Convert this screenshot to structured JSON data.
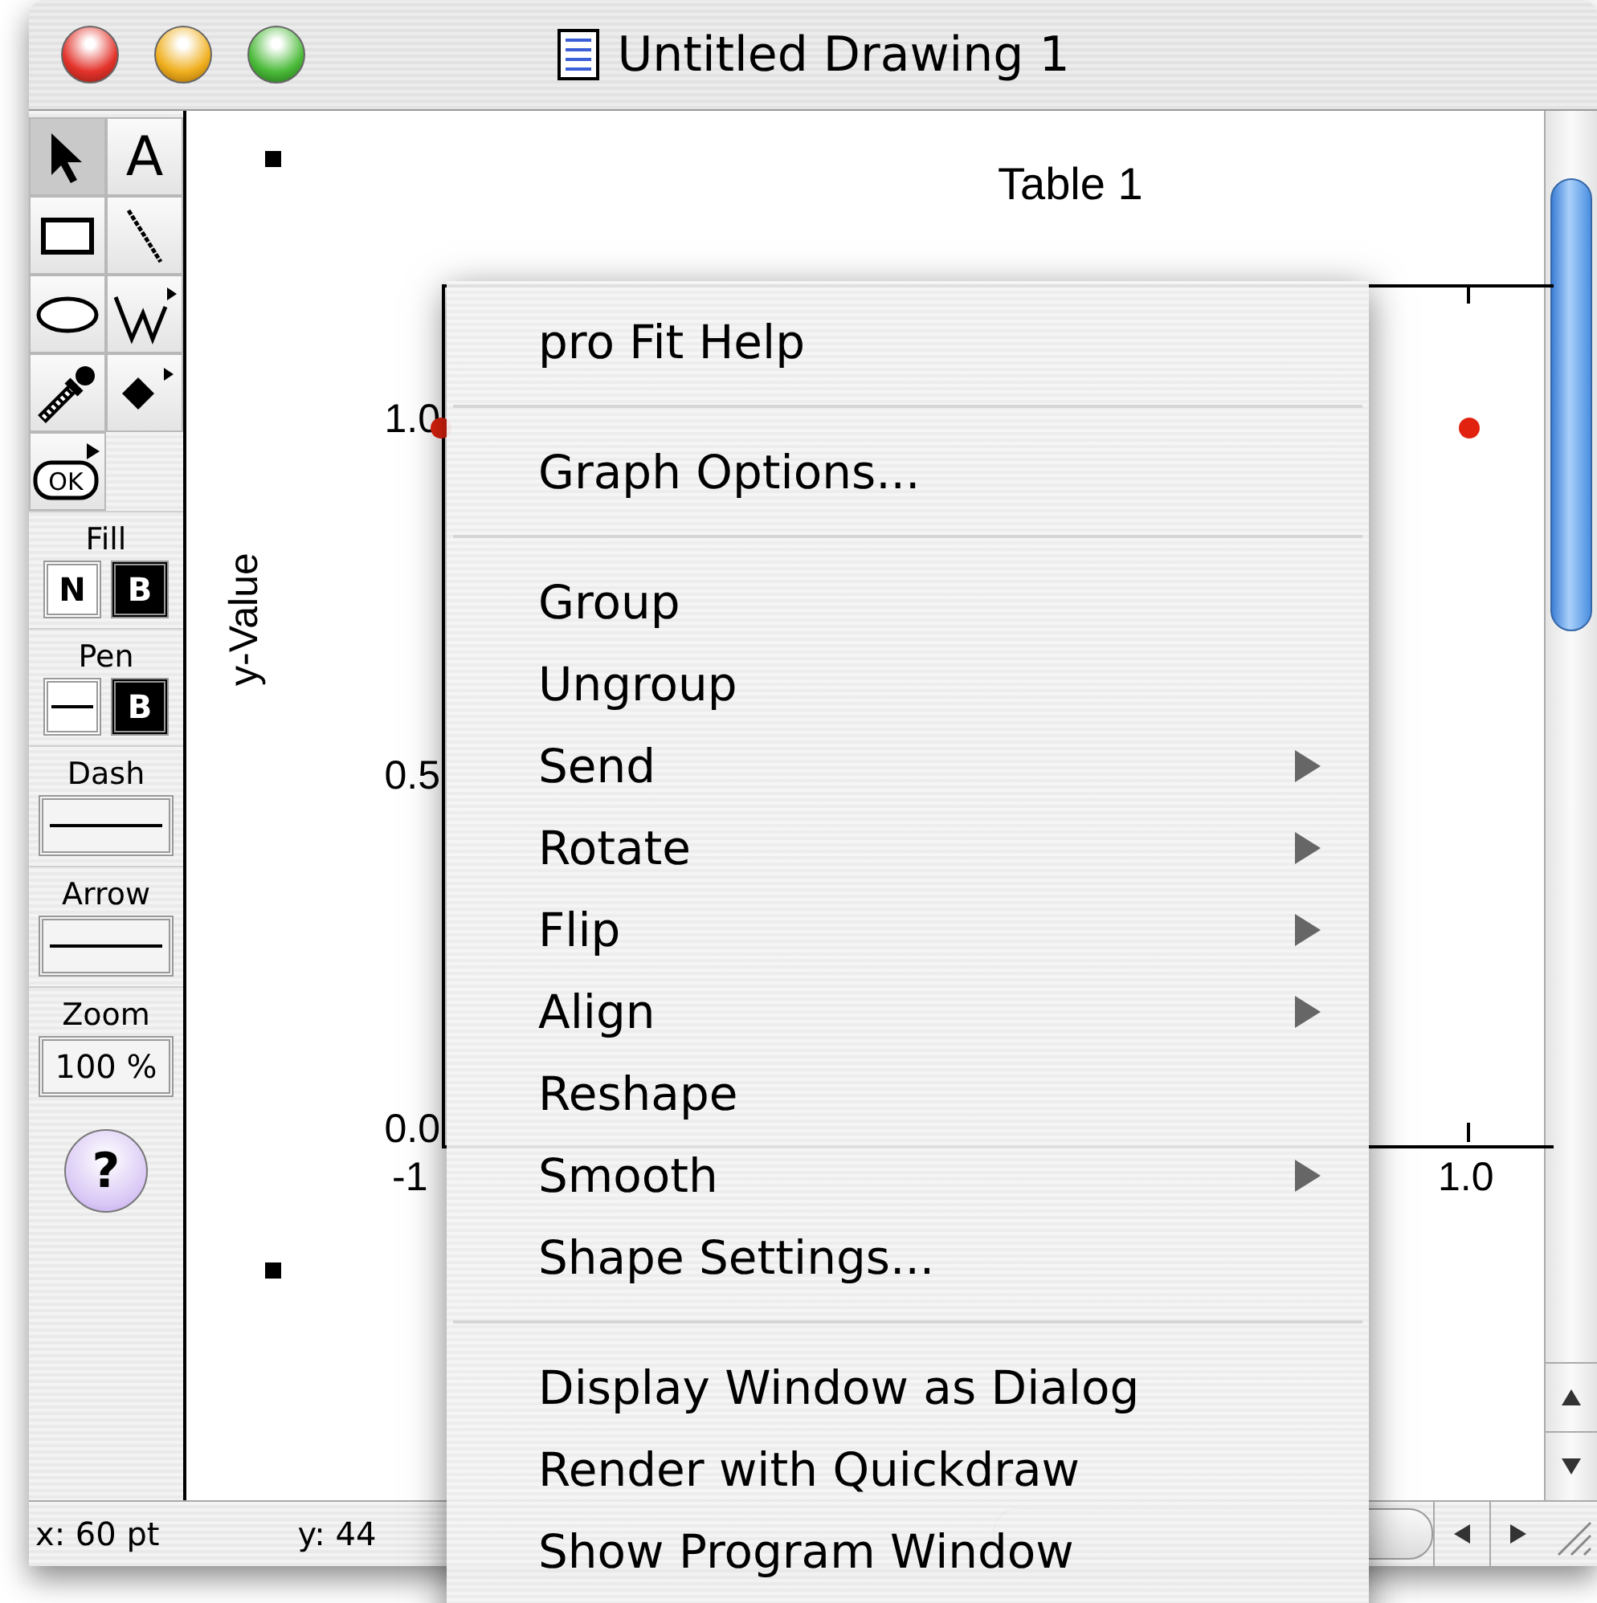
{
  "window": {
    "title": "Untitled Drawing 1"
  },
  "tools": [
    {
      "kind": "arrow",
      "selected": true
    },
    {
      "kind": "text",
      "label": "A",
      "selected": false
    },
    {
      "kind": "rectangle",
      "selected": false
    },
    {
      "kind": "line",
      "selected": false
    },
    {
      "kind": "oval",
      "selected": false
    },
    {
      "kind": "polyline",
      "selected": false
    },
    {
      "kind": "eyedropper",
      "selected": false
    },
    {
      "kind": "point",
      "selected": false
    },
    {
      "kind": "ok-button",
      "label": "OK",
      "selected": false
    }
  ],
  "fill": {
    "label": "Fill",
    "options": [
      "N",
      "B"
    ]
  },
  "pen": {
    "label": "Pen",
    "options": [
      "B"
    ]
  },
  "dash": {
    "label": "Dash"
  },
  "arrow": {
    "label": "Arrow"
  },
  "zoom": {
    "label": "Zoom",
    "value": "100 %"
  },
  "help": {
    "label": "?"
  },
  "graph": {
    "title": "Table 1",
    "y_label": "y-Value",
    "y_ticks": [
      "1.0",
      "0.5",
      "0.0"
    ],
    "x_ticks": [
      "-1",
      "1.0"
    ]
  },
  "status_bar": {
    "x": "x: 60 pt",
    "y": "y: 44"
  },
  "context_menu": [
    {
      "kind": "item",
      "label": "pro Fit Help",
      "submenu": false
    },
    {
      "kind": "separator"
    },
    {
      "kind": "item",
      "label": "Graph Options...",
      "submenu": false
    },
    {
      "kind": "separator"
    },
    {
      "kind": "item",
      "label": "Group",
      "submenu": false
    },
    {
      "kind": "item",
      "label": "Ungroup",
      "submenu": false
    },
    {
      "kind": "item",
      "label": "Send",
      "submenu": true
    },
    {
      "kind": "item",
      "label": "Rotate",
      "submenu": true
    },
    {
      "kind": "item",
      "label": "Flip",
      "submenu": true
    },
    {
      "kind": "item",
      "label": "Align",
      "submenu": true
    },
    {
      "kind": "item",
      "label": "Reshape",
      "submenu": false
    },
    {
      "kind": "item",
      "label": "Smooth",
      "submenu": true
    },
    {
      "kind": "item",
      "label": "Shape Settings...",
      "submenu": false
    },
    {
      "kind": "separator"
    },
    {
      "kind": "item",
      "label": "Display Window as Dialog",
      "submenu": false
    },
    {
      "kind": "item",
      "label": "Render with Quickdraw",
      "submenu": false
    },
    {
      "kind": "item",
      "label": "Show Program Window",
      "submenu": false
    }
  ]
}
